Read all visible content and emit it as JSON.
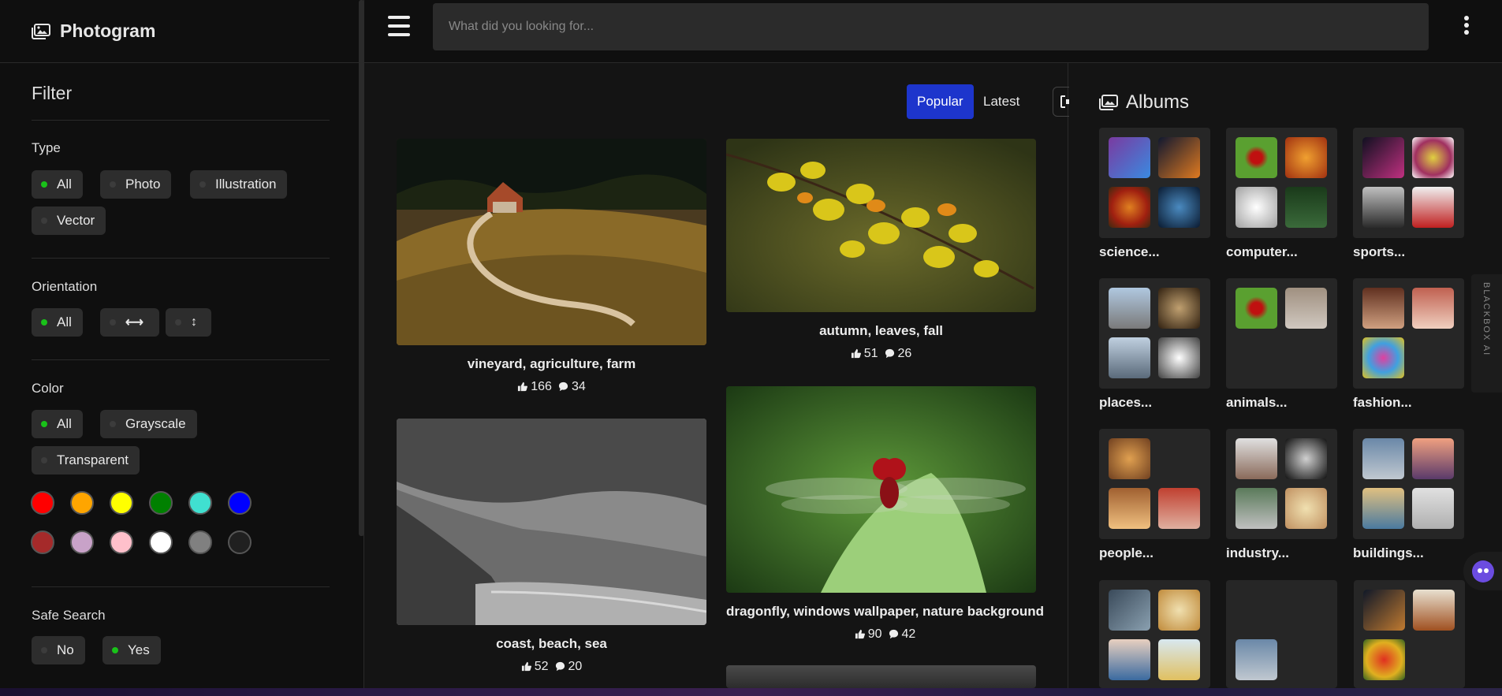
{
  "app": {
    "title": "Photogram"
  },
  "search": {
    "placeholder": "What did you looking for..."
  },
  "filter": {
    "heading": "Filter",
    "type": {
      "label": "Type",
      "options": [
        "All",
        "Photo",
        "Illustration",
        "Vector"
      ],
      "selected": "All"
    },
    "orientation": {
      "label": "Orientation",
      "options": [
        "All",
        "horizontal",
        "vertical"
      ],
      "selected": "All"
    },
    "color": {
      "label": "Color",
      "options": [
        "All",
        "Grayscale",
        "Transparent"
      ],
      "selected": "All",
      "swatches": [
        "#ff0000",
        "#ffa500",
        "#ffff00",
        "#008000",
        "#40e0d0",
        "#0000ff",
        "#a52a2a",
        "#c8a2c8",
        "#ffc0cb",
        "#ffffff",
        "#808080",
        "#202020"
      ]
    },
    "safe_search": {
      "label": "Safe Search",
      "options": [
        "No",
        "Yes"
      ],
      "selected": "Yes"
    }
  },
  "feed": {
    "tabs": [
      "Popular",
      "Latest"
    ],
    "active_tab": "Popular",
    "cards": [
      {
        "caption": "vineyard, agriculture, farm",
        "likes": "166",
        "comments": "34"
      },
      {
        "caption": "autumn, leaves, fall",
        "likes": "51",
        "comments": "26"
      },
      {
        "caption": "coast, beach, sea",
        "likes": "52",
        "comments": "20"
      },
      {
        "caption": "dragonfly, windows wallpaper, nature background",
        "likes": "90",
        "comments": "42"
      }
    ]
  },
  "albums": {
    "heading": "Albums",
    "items": [
      {
        "name": "science..."
      },
      {
        "name": "computer..."
      },
      {
        "name": "sports..."
      },
      {
        "name": "places..."
      },
      {
        "name": "animals..."
      },
      {
        "name": "fashion..."
      },
      {
        "name": "people..."
      },
      {
        "name": "industry..."
      },
      {
        "name": "buildings..."
      }
    ]
  },
  "widget": {
    "label": "BLACKBOX AI"
  }
}
